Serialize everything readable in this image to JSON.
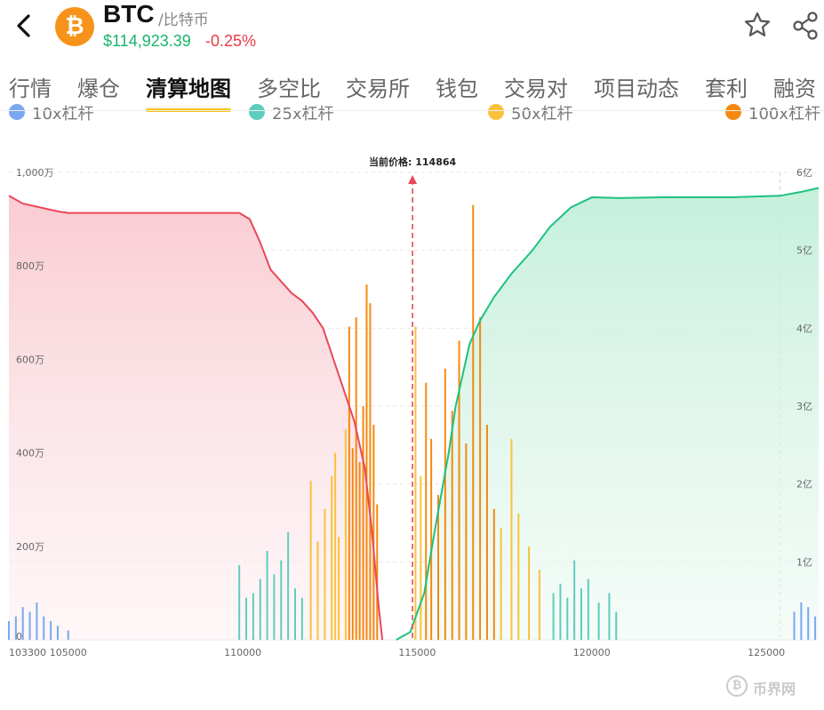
{
  "header": {
    "symbol": "BTC",
    "name": "/比特币",
    "price": "$114,923.39",
    "change": "-0.25%",
    "logo_glyph": "₿",
    "icons": [
      "back-arrow-icon",
      "bitcoin-logo-icon",
      "star-icon",
      "share-icon"
    ]
  },
  "tabs": [
    {
      "label": "行情",
      "active": false
    },
    {
      "label": "爆仓",
      "active": false
    },
    {
      "label": "清算地图",
      "active": true
    },
    {
      "label": "多空比",
      "active": false
    },
    {
      "label": "交易所",
      "active": false
    },
    {
      "label": "钱包",
      "active": false
    },
    {
      "label": "交易对",
      "active": false
    },
    {
      "label": "项目动态",
      "active": false
    },
    {
      "label": "套利",
      "active": false
    },
    {
      "label": "融资",
      "active": false
    }
  ],
  "legend": [
    {
      "label": "10x杠杆",
      "color": "#7aa7f2"
    },
    {
      "label": "25x杠杆",
      "color": "#5fcdbd"
    },
    {
      "label": "50x杠杆",
      "color": "#f9c23c"
    },
    {
      "label": "100x杠杆",
      "color": "#f5890f"
    }
  ],
  "watermark": {
    "text": "币界网",
    "icon_glyph": "₿"
  },
  "chart_data": {
    "type": "bar+area",
    "current_price_label": "当前价格: 114864",
    "current_price": 114864,
    "x_ticks": [
      "103300",
      "105000",
      "110000",
      "115000",
      "120000",
      "125000"
    ],
    "x_tick_values": [
      103300,
      105000,
      110000,
      115000,
      120000,
      125000
    ],
    "x_range": [
      103300,
      126500
    ],
    "y_left_ticks": [
      "1,000万",
      "800万",
      "600万",
      "400万",
      "200万",
      "0"
    ],
    "y_left_values": [
      10000000,
      8000000,
      6000000,
      4000000,
      2000000,
      0
    ],
    "y_right_ticks": [
      "6亿",
      "5亿",
      "4亿",
      "3亿",
      "2亿",
      "1亿",
      "0"
    ],
    "y_right_values": [
      600000000,
      500000000,
      400000000,
      300000000,
      200000000,
      100000000,
      0
    ],
    "y_left_range": [
      0,
      10000000
    ],
    "y_right_range": [
      0,
      600000000
    ],
    "cumulative_long": {
      "color": "#e8485a",
      "points": [
        [
          103300,
          570000000
        ],
        [
          103700,
          560000000
        ],
        [
          104700,
          550000000
        ],
        [
          105000,
          548000000
        ],
        [
          106500,
          548000000
        ],
        [
          109900,
          548000000
        ],
        [
          110200,
          540000000
        ],
        [
          110500,
          510000000
        ],
        [
          110800,
          475000000
        ],
        [
          111400,
          445000000
        ],
        [
          111700,
          435000000
        ],
        [
          112000,
          420000000
        ],
        [
          112300,
          400000000
        ],
        [
          112600,
          360000000
        ],
        [
          112900,
          320000000
        ],
        [
          113200,
          280000000
        ],
        [
          113500,
          220000000
        ],
        [
          113700,
          140000000
        ],
        [
          113900,
          40000000
        ],
        [
          114000,
          0
        ]
      ]
    },
    "cumulative_short": {
      "color": "#1ec180",
      "points": [
        [
          114400,
          0
        ],
        [
          114800,
          10000000
        ],
        [
          115200,
          60000000
        ],
        [
          115500,
          140000000
        ],
        [
          115700,
          190000000
        ],
        [
          115900,
          240000000
        ],
        [
          116100,
          300000000
        ],
        [
          116300,
          340000000
        ],
        [
          116500,
          380000000
        ],
        [
          116800,
          410000000
        ],
        [
          117200,
          440000000
        ],
        [
          117700,
          470000000
        ],
        [
          118300,
          500000000
        ],
        [
          118800,
          530000000
        ],
        [
          119400,
          555000000
        ],
        [
          120000,
          568000000
        ],
        [
          120800,
          567000000
        ],
        [
          122000,
          568000000
        ],
        [
          124000,
          568000000
        ],
        [
          125400,
          570000000
        ],
        [
          126000,
          575000000
        ],
        [
          126500,
          580000000
        ]
      ]
    },
    "series_colors": {
      "10x": "#7aa7f2",
      "25x": "#5fcdbd",
      "50x": "#f9c23c",
      "100x": "#f5890f"
    },
    "bars": [
      {
        "x": 103300,
        "v": 400000,
        "s": "10x"
      },
      {
        "x": 103500,
        "v": 500000,
        "s": "10x"
      },
      {
        "x": 103700,
        "v": 700000,
        "s": "10x"
      },
      {
        "x": 103900,
        "v": 600000,
        "s": "10x"
      },
      {
        "x": 104100,
        "v": 800000,
        "s": "10x"
      },
      {
        "x": 104300,
        "v": 500000,
        "s": "10x"
      },
      {
        "x": 104500,
        "v": 400000,
        "s": "10x"
      },
      {
        "x": 104700,
        "v": 300000,
        "s": "10x"
      },
      {
        "x": 105000,
        "v": 200000,
        "s": "10x"
      },
      {
        "x": 109900,
        "v": 1600000,
        "s": "25x"
      },
      {
        "x": 110100,
        "v": 900000,
        "s": "25x"
      },
      {
        "x": 110300,
        "v": 1000000,
        "s": "25x"
      },
      {
        "x": 110500,
        "v": 1300000,
        "s": "25x"
      },
      {
        "x": 110700,
        "v": 1900000,
        "s": "25x"
      },
      {
        "x": 110900,
        "v": 1400000,
        "s": "25x"
      },
      {
        "x": 111100,
        "v": 1700000,
        "s": "25x"
      },
      {
        "x": 111300,
        "v": 2300000,
        "s": "25x"
      },
      {
        "x": 111500,
        "v": 1100000,
        "s": "25x"
      },
      {
        "x": 111700,
        "v": 900000,
        "s": "25x"
      },
      {
        "x": 111950,
        "v": 3400000,
        "s": "50x"
      },
      {
        "x": 112150,
        "v": 2100000,
        "s": "50x"
      },
      {
        "x": 112350,
        "v": 2800000,
        "s": "50x"
      },
      {
        "x": 112550,
        "v": 3500000,
        "s": "50x"
      },
      {
        "x": 112650,
        "v": 4000000,
        "s": "50x"
      },
      {
        "x": 112750,
        "v": 2200000,
        "s": "50x"
      },
      {
        "x": 112950,
        "v": 4500000,
        "s": "50x"
      },
      {
        "x": 113050,
        "v": 6700000,
        "s": "100x"
      },
      {
        "x": 113150,
        "v": 4100000,
        "s": "100x"
      },
      {
        "x": 113250,
        "v": 6900000,
        "s": "100x"
      },
      {
        "x": 113350,
        "v": 3800000,
        "s": "100x"
      },
      {
        "x": 113450,
        "v": 5000000,
        "s": "100x"
      },
      {
        "x": 113550,
        "v": 7600000,
        "s": "100x"
      },
      {
        "x": 113650,
        "v": 7200000,
        "s": "100x"
      },
      {
        "x": 113750,
        "v": 4600000,
        "s": "100x"
      },
      {
        "x": 113850,
        "v": 2900000,
        "s": "100x"
      },
      {
        "x": 114950,
        "v": 6700000,
        "s": "50x"
      },
      {
        "x": 115100,
        "v": 3500000,
        "s": "50x"
      },
      {
        "x": 115250,
        "v": 5500000,
        "s": "100x"
      },
      {
        "x": 115400,
        "v": 4300000,
        "s": "100x"
      },
      {
        "x": 115600,
        "v": 3100000,
        "s": "100x"
      },
      {
        "x": 115800,
        "v": 5800000,
        "s": "100x"
      },
      {
        "x": 116000,
        "v": 4900000,
        "s": "100x"
      },
      {
        "x": 116200,
        "v": 6400000,
        "s": "100x"
      },
      {
        "x": 116400,
        "v": 4200000,
        "s": "100x"
      },
      {
        "x": 116600,
        "v": 9300000,
        "s": "100x"
      },
      {
        "x": 116800,
        "v": 6900000,
        "s": "100x"
      },
      {
        "x": 117000,
        "v": 4600000,
        "s": "100x"
      },
      {
        "x": 117200,
        "v": 2800000,
        "s": "100x"
      },
      {
        "x": 117400,
        "v": 2400000,
        "s": "50x"
      },
      {
        "x": 117700,
        "v": 4300000,
        "s": "50x"
      },
      {
        "x": 117900,
        "v": 2700000,
        "s": "50x"
      },
      {
        "x": 118200,
        "v": 2000000,
        "s": "50x"
      },
      {
        "x": 118500,
        "v": 1500000,
        "s": "50x"
      },
      {
        "x": 118900,
        "v": 1000000,
        "s": "25x"
      },
      {
        "x": 119100,
        "v": 1200000,
        "s": "25x"
      },
      {
        "x": 119300,
        "v": 900000,
        "s": "25x"
      },
      {
        "x": 119500,
        "v": 1700000,
        "s": "25x"
      },
      {
        "x": 119700,
        "v": 1100000,
        "s": "25x"
      },
      {
        "x": 119900,
        "v": 1300000,
        "s": "25x"
      },
      {
        "x": 120200,
        "v": 800000,
        "s": "25x"
      },
      {
        "x": 120500,
        "v": 1000000,
        "s": "25x"
      },
      {
        "x": 120700,
        "v": 600000,
        "s": "25x"
      },
      {
        "x": 125800,
        "v": 600000,
        "s": "10x"
      },
      {
        "x": 126000,
        "v": 800000,
        "s": "10x"
      },
      {
        "x": 126200,
        "v": 700000,
        "s": "10x"
      },
      {
        "x": 126400,
        "v": 500000,
        "s": "10x"
      }
    ]
  }
}
